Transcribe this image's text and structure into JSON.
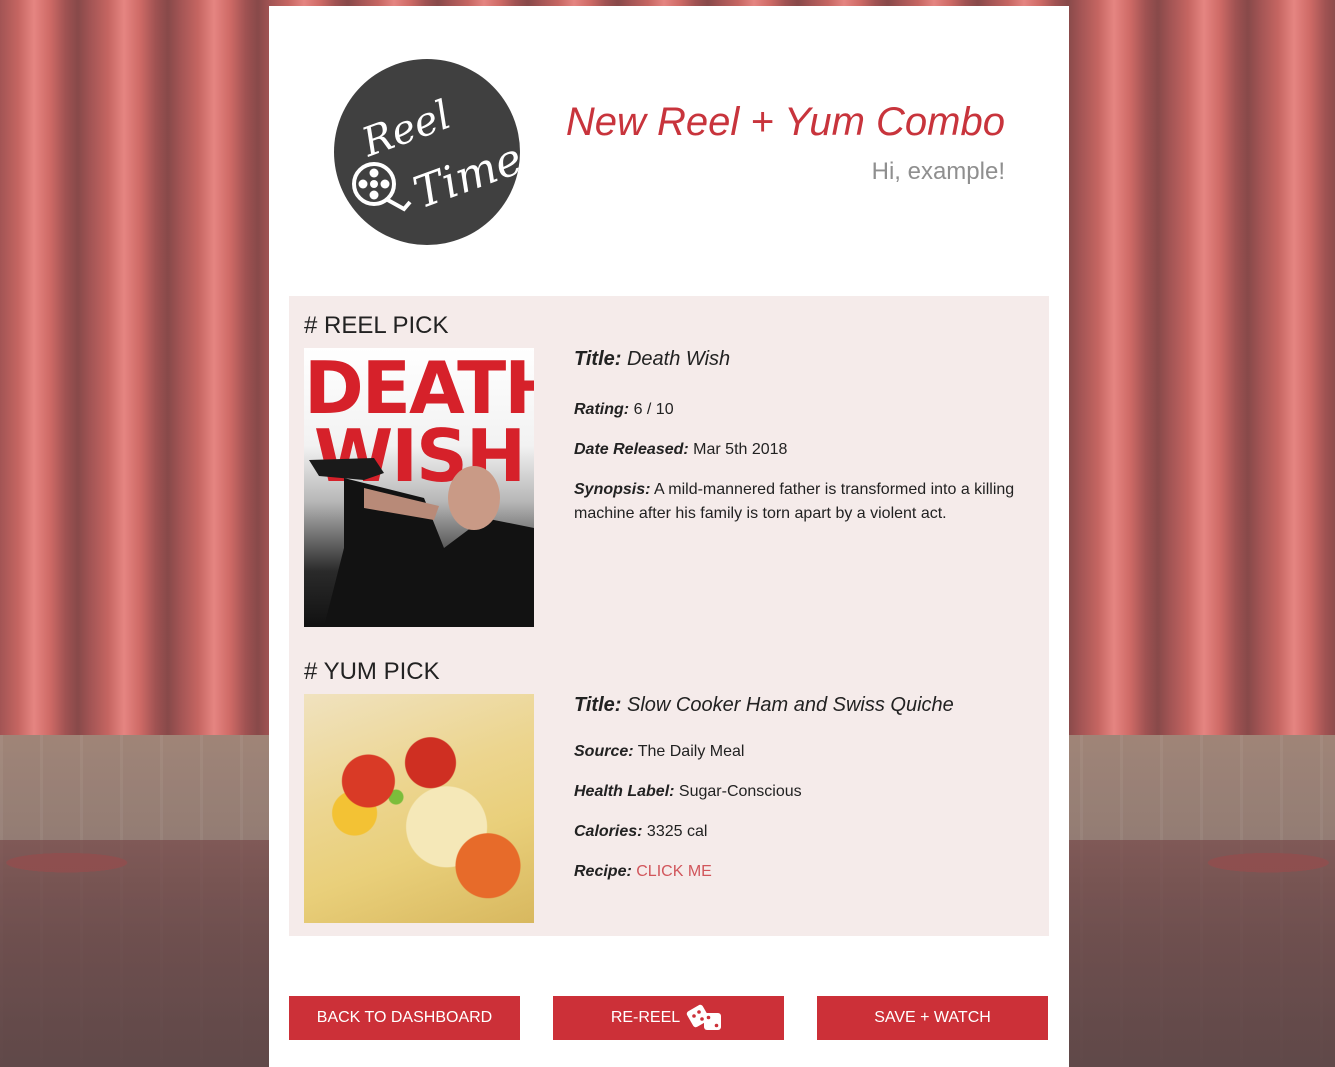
{
  "header": {
    "logo_text_line1": "Reel",
    "logo_text_line2": "Time",
    "title": "New Reel + Yum Combo",
    "greeting": "Hi, example!"
  },
  "reel": {
    "section_title": "# REEL PICK",
    "poster_text": "DEATH WISH",
    "title_label": "Title:",
    "title_value": "Death Wish",
    "rating_label": "Rating:",
    "rating_value": "6 / 10",
    "released_label": "Date Released:",
    "released_value": "Mar 5th 2018",
    "synopsis_label": "Synopsis:",
    "synopsis_value": "A mild-mannered father is transformed into a killing machine after his family is torn apart by a violent act."
  },
  "yum": {
    "section_title": "# YUM PICK",
    "title_label": "Title:",
    "title_value": "Slow Cooker Ham and Swiss Quiche",
    "source_label": "Source:",
    "source_value": "The Daily Meal",
    "health_label": "Health Label:",
    "health_value": "Sugar-Conscious",
    "calories_label": "Calories:",
    "calories_value": "3325 cal",
    "recipe_label": "Recipe:",
    "recipe_link": "CLICK ME"
  },
  "buttons": {
    "back": "BACK TO DASHBOARD",
    "rereel": "RE-REEL",
    "save": "SAVE + WATCH",
    "rereel_icon": "dice-icon"
  },
  "colors": {
    "accent": "#cc3038",
    "panel_bg": "#f5ebea",
    "link": "#d1555b",
    "logo_bg": "#404040"
  }
}
